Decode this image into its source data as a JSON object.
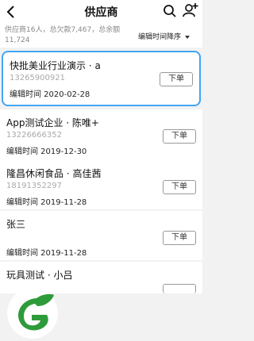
{
  "header": {
    "title": "供应商"
  },
  "summary": {
    "text": "供应商16人，总欠款7,467，总余额11,724",
    "sort_label": "编辑时间降序"
  },
  "suppliers": [
    {
      "name": "快批美业行业演示 · a",
      "phone": "13265900921",
      "edit_time": "编辑时间 2020-02-28",
      "button": "下单"
    },
    {
      "name": "App测试企业 · 陈唯+",
      "phone": "13226666352",
      "edit_time": "编辑时间 2019-12-30",
      "button": "下单"
    },
    {
      "name": "隆昌休闲食品 · 高佳茜",
      "phone": "18191352297",
      "edit_time": "编辑时间 2019-11-28",
      "button": "下单"
    },
    {
      "name": "张三",
      "phone": "",
      "edit_time": "编辑时间 2019-11-28",
      "button": "下单"
    },
    {
      "name": "玩具测试 · 小吕",
      "phone": "",
      "edit_time": "",
      "button": ""
    }
  ],
  "colors": {
    "selected_border": "#42a5f5",
    "logo_green": "#2e9b3a"
  }
}
